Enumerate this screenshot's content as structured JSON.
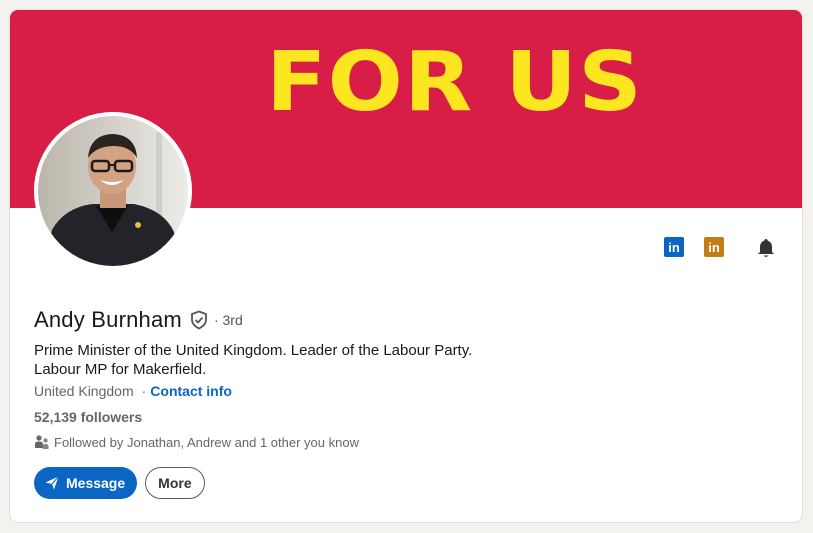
{
  "banner": {
    "text": "FOR US"
  },
  "profile": {
    "name": "Andy Burnham",
    "degree": "· 3rd",
    "headline_line1": "Prime Minister of the United Kingdom. Leader of the Labour Party.",
    "headline_line2": "Labour MP for Makerfield.",
    "location": "United Kingdom",
    "contact_separator": "·",
    "contact_label": "Contact info",
    "followers": "52,139 followers",
    "mutual": "Followed by Jonathan, Andrew and 1 other you know"
  },
  "buttons": {
    "message": "Message",
    "more": "More"
  },
  "icons": {
    "linkedin_blue": "linkedin-icon",
    "linkedin_gold": "linkedin-premium-icon",
    "bell": "bell-icon",
    "verified": "verified-shield-icon",
    "mutual": "people-icon",
    "send": "send-icon",
    "linkedin_letters": "in"
  },
  "colors": {
    "banner": "#d81e47",
    "banner_text": "#fbe620",
    "accent": "#0a66c2",
    "premium": "#c37d16"
  }
}
